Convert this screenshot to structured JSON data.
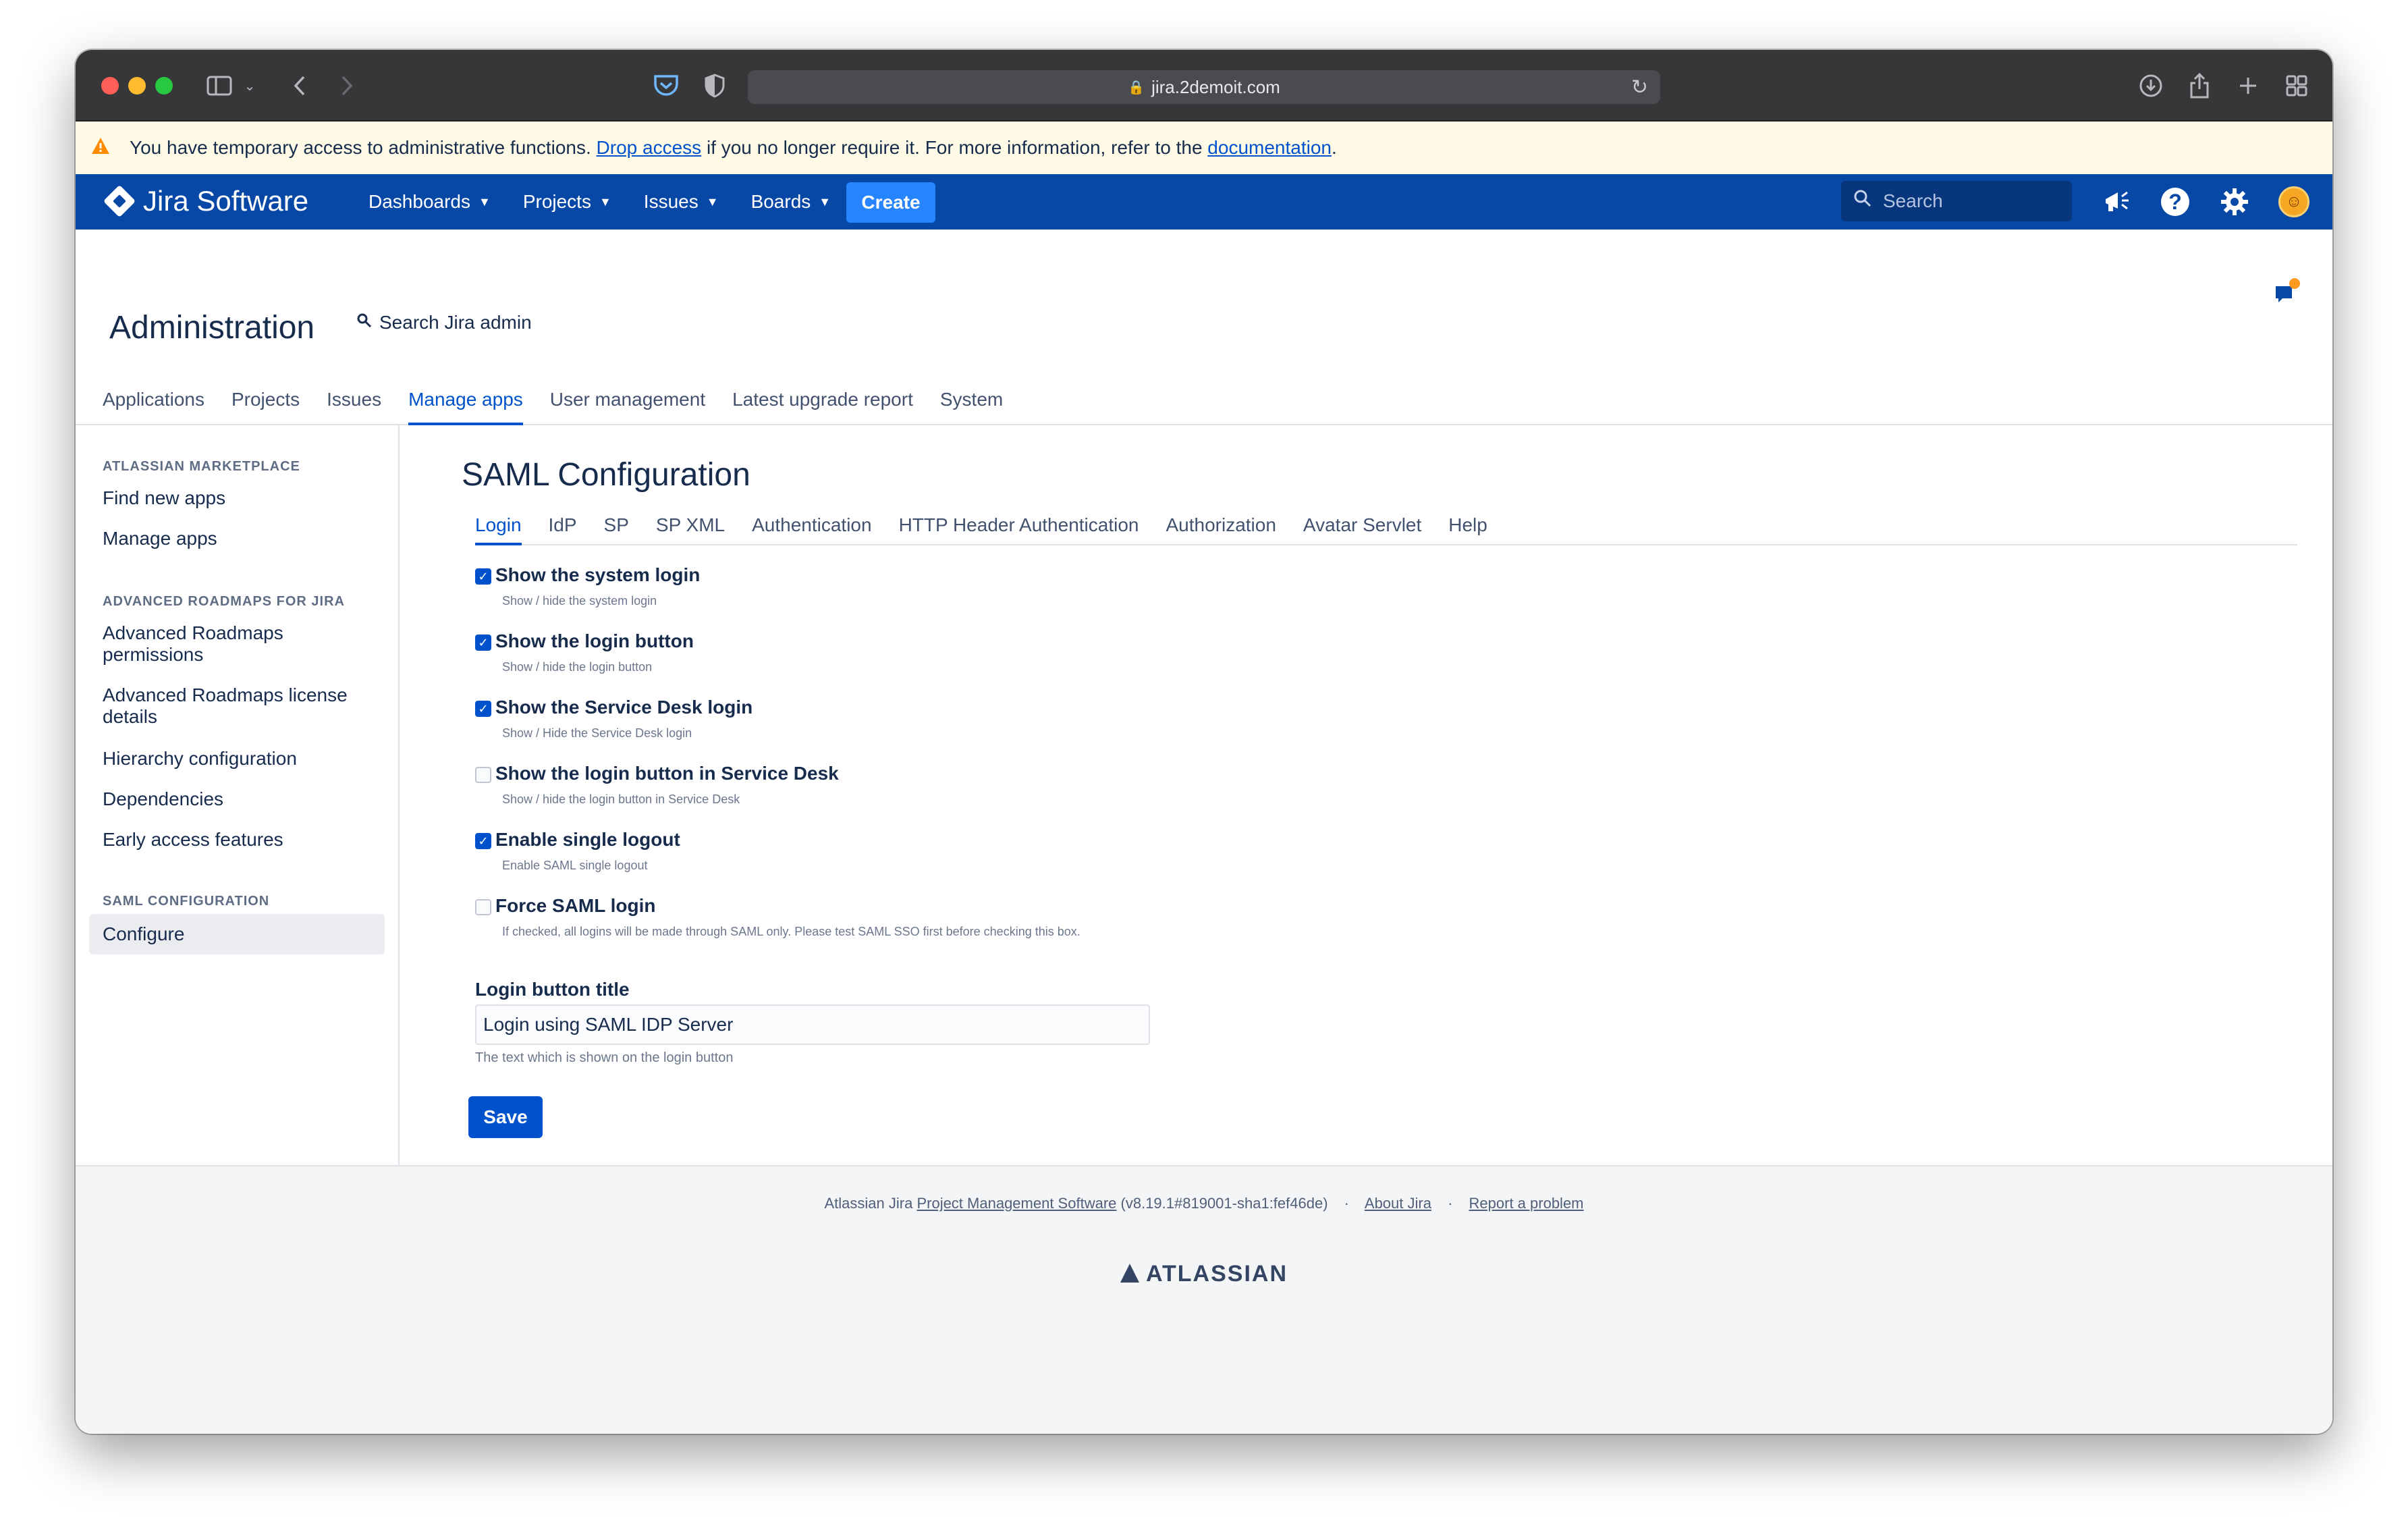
{
  "browser": {
    "url": "jira.2demoit.com"
  },
  "banner": {
    "text_before": "You have temporary access to administrative functions.",
    "drop_link": "Drop access",
    "text_middle": "if you no longer require it. For more information, refer to the",
    "doc_link": "documentation",
    "text_after": "."
  },
  "topnav": {
    "product": "Jira Software",
    "menus": [
      "Dashboards",
      "Projects",
      "Issues",
      "Boards"
    ],
    "create_label": "Create",
    "search_placeholder": "Search"
  },
  "admin": {
    "title": "Administration",
    "search_label": "Search Jira admin",
    "tabs": [
      "Applications",
      "Projects",
      "Issues",
      "Manage apps",
      "User management",
      "Latest upgrade report",
      "System"
    ],
    "active_tab": "Manage apps"
  },
  "sidebar": {
    "sections": [
      {
        "heading": "ATLASSIAN MARKETPLACE",
        "items": [
          "Find new apps",
          "Manage apps"
        ]
      },
      {
        "heading": "ADVANCED ROADMAPS FOR JIRA",
        "items": [
          "Advanced Roadmaps permissions",
          "Advanced Roadmaps license details",
          "Hierarchy configuration",
          "Dependencies",
          "Early access features"
        ]
      },
      {
        "heading": "SAML CONFIGURATION",
        "items": [
          "Configure"
        ]
      }
    ],
    "selected_item": "Configure"
  },
  "saml": {
    "title": "SAML Configuration",
    "tabs": [
      "Login",
      "IdP",
      "SP",
      "SP XML",
      "Authentication",
      "HTTP Header Authentication",
      "Authorization",
      "Avatar Servlet",
      "Help"
    ],
    "active_tab": "Login",
    "options": [
      {
        "label": "Show the system login",
        "desc": "Show / hide the system login",
        "checked": true
      },
      {
        "label": "Show the login button",
        "desc": "Show / hide the login button",
        "checked": true
      },
      {
        "label": "Show the Service Desk login",
        "desc": "Show / Hide the Service Desk login",
        "checked": true
      },
      {
        "label": "Show the login button in Service Desk",
        "desc": "Show / hide the login button in Service Desk",
        "checked": false
      },
      {
        "label": "Enable single logout",
        "desc": "Enable SAML single logout",
        "checked": true
      },
      {
        "label": "Force SAML login",
        "desc": "If checked, all logins will be made through SAML only. Please test SAML SSO first before checking this box.",
        "checked": false
      }
    ],
    "login_button_title_label": "Login button title",
    "login_button_title_value": "Login using SAML IDP Server",
    "login_button_title_desc": "The text which is shown on the login button",
    "save_label": "Save"
  },
  "footer": {
    "prefix": "Atlassian Jira",
    "pms_link": "Project Management Software",
    "version": "(v8.19.1#819001-sha1:fef46de)",
    "about_link": "About Jira",
    "report_link": "Report a problem",
    "logo_text": "ATLASSIAN"
  },
  "colors": {
    "nav_bg": "#0747a6",
    "accent": "#0052cc",
    "create_btn": "#2684ff",
    "banner_bg": "#fffae6"
  }
}
